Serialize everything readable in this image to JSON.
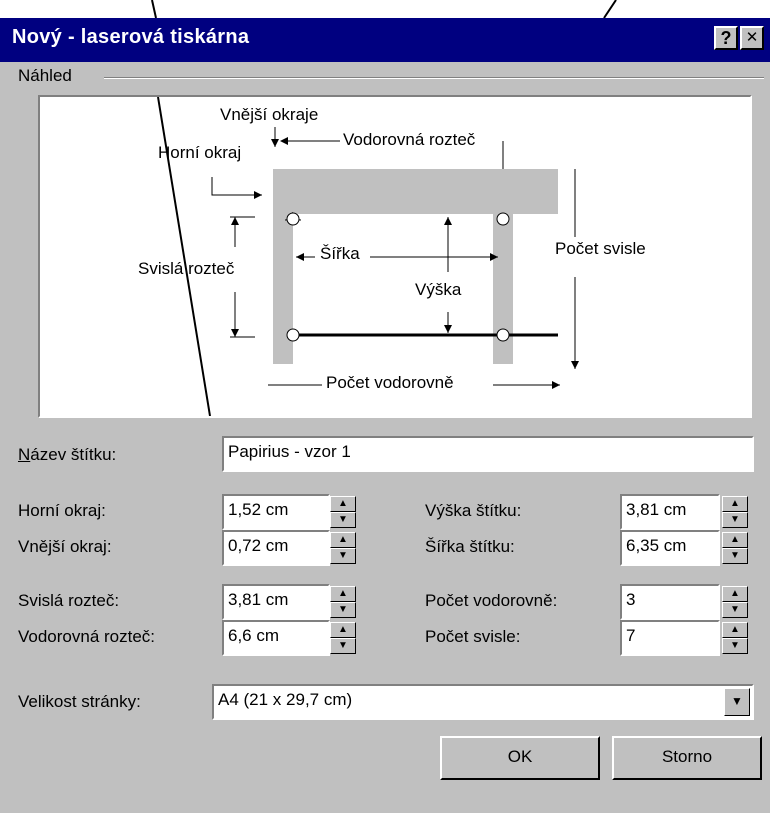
{
  "window": {
    "title": "Nový - laserová tiskárna",
    "help_button": "?",
    "close_button": "✕"
  },
  "preview": {
    "group_label": "Náhled",
    "labels": {
      "outer_margin": "Vnější okraje",
      "top_margin": "Horní okraj",
      "horizontal_pitch": "Vodorovná rozteč",
      "vertical_pitch": "Svislá rozteč",
      "width": "Šířka",
      "height": "Výška",
      "number_down": "Počet svisle",
      "number_across": "Počet vodorovně"
    }
  },
  "form": {
    "label_name": {
      "label": "Název štítku:",
      "value": "Papirius - vzor 1"
    },
    "top_margin": {
      "label": "Horní okraj:",
      "value": "1,52 cm"
    },
    "side_margin": {
      "label": "Vnější okraj:",
      "value": "0,72 cm"
    },
    "vertical_pitch": {
      "label": "Svislá rozteč:",
      "value": "3,81 cm"
    },
    "horizontal_pitch": {
      "label": "Vodorovná rozteč:",
      "value": "6,6 cm"
    },
    "label_height": {
      "label": "Výška štítku:",
      "value": "3,81 cm"
    },
    "label_width": {
      "label": "Šířka štítku:",
      "value": "6,35 cm"
    },
    "number_across": {
      "label": "Počet vodorovně:",
      "value": "3"
    },
    "number_down": {
      "label": "Počet svisle:",
      "value": "7"
    },
    "page_size": {
      "label": "Velikost stránky:",
      "value": "A4 (21 x 29,7 cm)"
    }
  },
  "buttons": {
    "ok": "OK",
    "cancel": "Storno"
  },
  "colors": {
    "titlebar": "#000080",
    "face": "#c0c0c0",
    "label_shape": "#c0c0c0"
  }
}
